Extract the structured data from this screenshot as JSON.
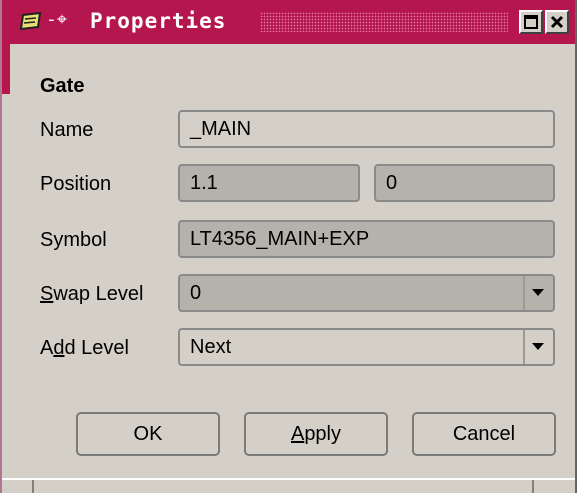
{
  "window": {
    "title": "Properties",
    "accent_color": "#b5164e",
    "icons": [
      "window-menu-icon",
      "pin-icon",
      "maximize-icon",
      "close-icon"
    ]
  },
  "form": {
    "section_title": "Gate",
    "name": {
      "label": "Name",
      "value": "_MAIN"
    },
    "position": {
      "label": "Position",
      "x": "1.1",
      "y": "0"
    },
    "symbol": {
      "label": "Symbol",
      "value": "LT4356_MAIN+EXP"
    },
    "swap_level": {
      "label_mnemonic": "S",
      "label_rest": "wap Level",
      "value": "0"
    },
    "add_level": {
      "label_pre": "A",
      "label_mnemonic": "d",
      "label_rest": "d Level",
      "value": "Next"
    }
  },
  "buttons": {
    "ok": "OK",
    "apply_mnemonic": "A",
    "apply_rest": "pply",
    "cancel": "Cancel"
  }
}
